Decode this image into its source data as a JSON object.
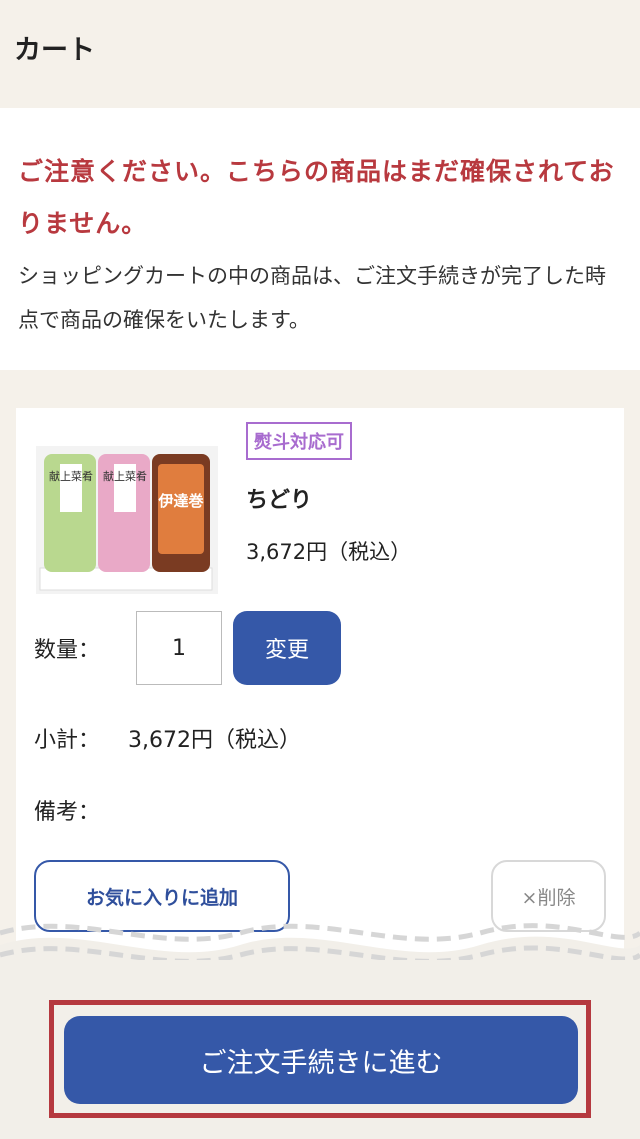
{
  "header": {
    "title": "カート"
  },
  "notice": {
    "warning": "ご注意ください。こちらの商品はまだ確保されておりません。",
    "body": "ショッピングカートの中の商品は、ご注文手続きが完了した時点で商品の確保をいたします。"
  },
  "item": {
    "badge": "熨斗対応可",
    "name": "ちどり",
    "price": "3,672円（税込）",
    "image_labels": [
      "献上菜肴",
      "献上菜肴",
      "伊達巻"
    ],
    "quantity_label": "数量：",
    "quantity_value": "1",
    "change_label": "変更",
    "subtotal_label": "小計：",
    "subtotal_value": "3,672円（税込）",
    "remarks_label": "備考：",
    "favorite_label": "お気に入りに追加",
    "delete_label": "×削除"
  },
  "footer": {
    "checkout_label": "ご注文手続きに進む"
  },
  "colors": {
    "accent": "#3558a8",
    "warning": "#b8393f",
    "badge": "#a86ccf",
    "background": "#f5f1ea"
  }
}
